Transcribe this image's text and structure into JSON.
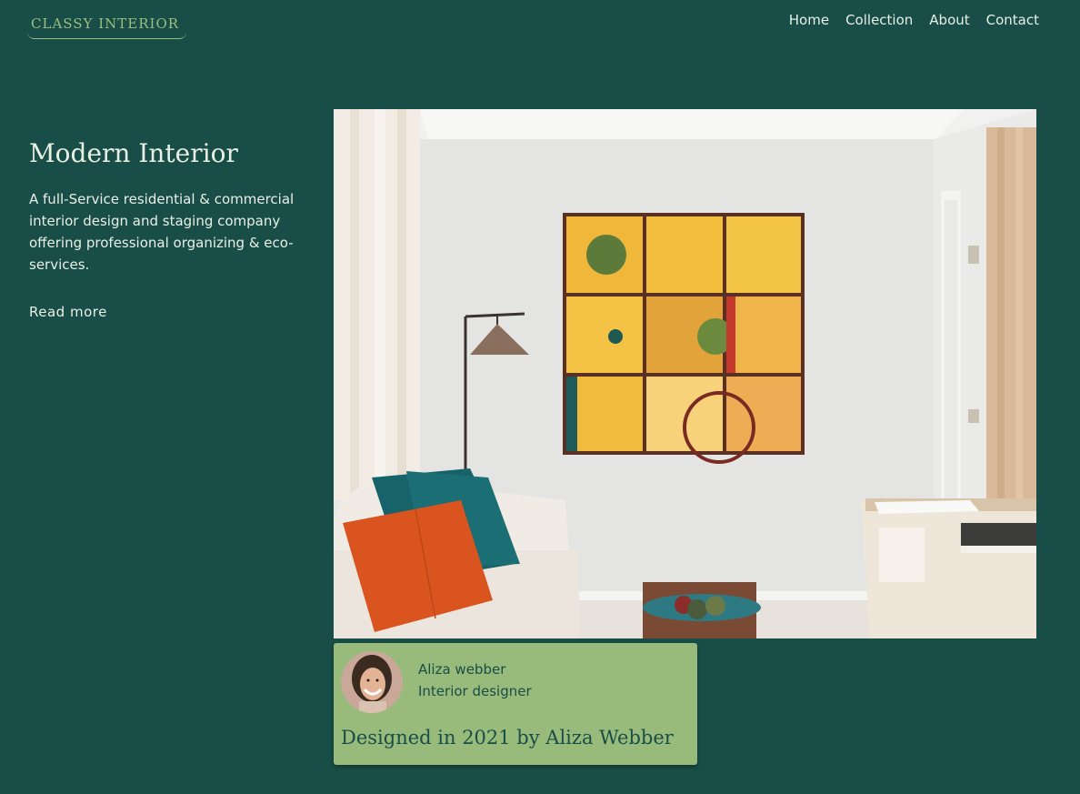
{
  "header": {
    "logo_text": "CLASSY INTERIOR",
    "nav": [
      {
        "label": "Home"
      },
      {
        "label": "Collection"
      },
      {
        "label": "About"
      },
      {
        "label": "Contact"
      }
    ]
  },
  "hero": {
    "title": "Modern Interior",
    "description": "A full-Service residential & commercial interior design and staging company offering professional organizing & eco-services.",
    "read_more_label": "Read more"
  },
  "designer_card": {
    "name": "Aliza webber",
    "role": "Interior designer",
    "credit": "Designed in 2021 by Aliza Webber"
  },
  "colors": {
    "background": "#194d47",
    "accent": "#98bb7c",
    "text_light": "#e8f0e4"
  }
}
